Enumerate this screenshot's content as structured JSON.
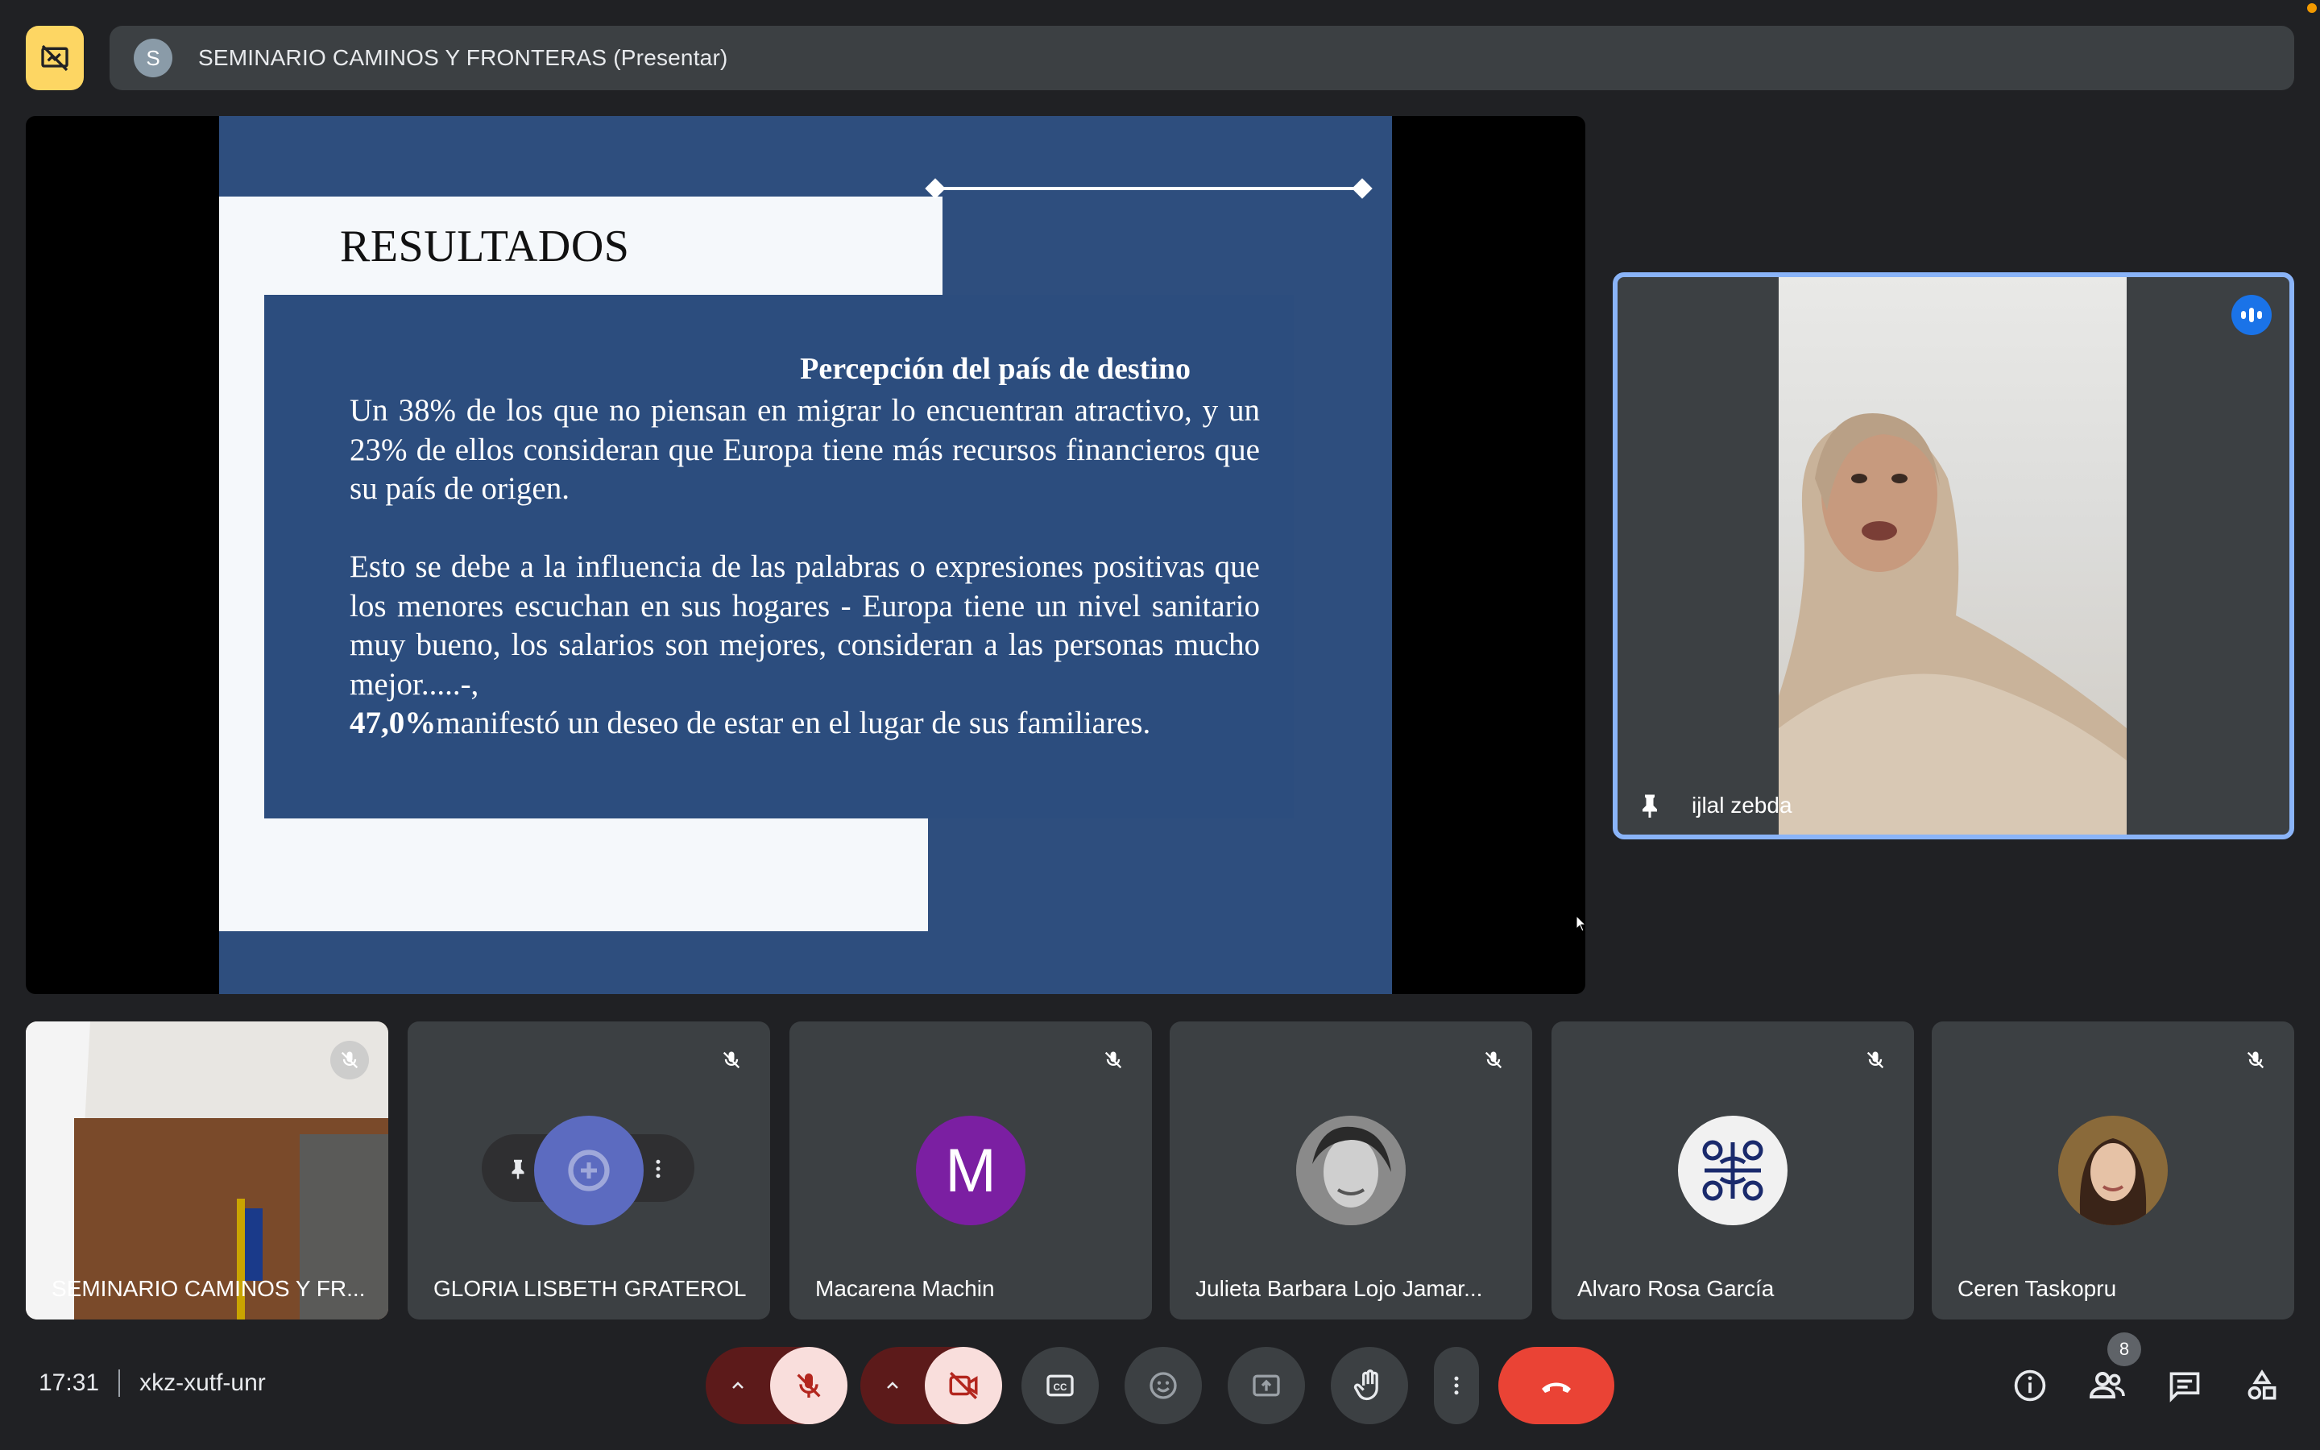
{
  "meeting": {
    "title_avatar_letter": "S",
    "title": "SEMINARIO CAMINOS Y FRONTERAS (Presentar)",
    "time": "17:31",
    "code": "xkz-xutf-unr"
  },
  "slide": {
    "title": "RESULTADOS",
    "heading": "Percepción del país de destino",
    "paragraph1": "Un 38% de los que no piensan en migrar lo encuentran atractivo, y un 23% de ellos consideran que Europa tiene más recursos financieros que su país de origen.",
    "paragraph2": "Esto se debe a la influencia de las palabras o expresiones positivas que los menores escuchan en sus hogares - Europa tiene un nivel sanitario muy bueno, los salarios son mejores, consideran a las personas mucho mejor.....-,",
    "paragraph3_bold": "47,0%",
    "paragraph3_rest": "manifestó un deseo de estar en el lugar de sus familiares."
  },
  "speaker": {
    "name": "ijlal zebda"
  },
  "participants": [
    {
      "name": "SEMINARIO CAMINOS Y FR...",
      "avatar": "camera-video"
    },
    {
      "name": "GLORIA LISBETH GRATEROL",
      "avatar": "logo"
    },
    {
      "name": "Macarena Machin",
      "avatar_letter": "M"
    },
    {
      "name": "Julieta Barbara Lojo Jamar...",
      "avatar": "photo"
    },
    {
      "name": "Alvaro Rosa García",
      "avatar": "pattern"
    },
    {
      "name": "Ceren Taskopru",
      "avatar": "photo"
    }
  ],
  "people_count": "8",
  "colors": {
    "accent_blue": "#8ab4f8",
    "slide_blue": "#2e4e7e",
    "end_call_red": "#ea4335",
    "present_yellow": "#fdd663",
    "avatar_purple": "#6a1b9a"
  }
}
